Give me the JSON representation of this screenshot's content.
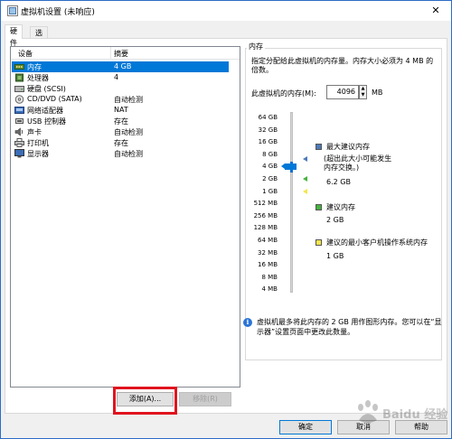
{
  "window": {
    "title": "虚拟机设置 (未响应)",
    "close": "✕"
  },
  "tabs": [
    {
      "label": "硬件",
      "active": true
    },
    {
      "label": "选项",
      "active": false
    }
  ],
  "device_list": {
    "headers": [
      "设备",
      "摘要"
    ],
    "rows": [
      {
        "name": "内存",
        "summary": "4 GB",
        "icon": "memory-icon",
        "selected": true
      },
      {
        "name": "处理器",
        "summary": "4",
        "icon": "processor-icon"
      },
      {
        "name": "硬盘 (SCSI)",
        "summary": "",
        "icon": "hard-disk-icon"
      },
      {
        "name": "CD/DVD (SATA)",
        "summary": "自动检测",
        "icon": "cd-dvd-icon"
      },
      {
        "name": "网络适配器",
        "summary": "NAT",
        "icon": "network-adapter-icon"
      },
      {
        "name": "USB 控制器",
        "summary": "存在",
        "icon": "usb-controller-icon"
      },
      {
        "name": "声卡",
        "summary": "自动检测",
        "icon": "sound-card-icon"
      },
      {
        "name": "打印机",
        "summary": "存在",
        "icon": "printer-icon"
      },
      {
        "name": "显示器",
        "summary": "自动检测",
        "icon": "display-icon"
      }
    ],
    "add_button": "添加(A)...",
    "remove_button": "移除(R)"
  },
  "memory": {
    "group_title": "内存",
    "description": "指定分配给此虚拟机的内存量。内存大小必须为 4 MB 的倍数。",
    "field_label": "此虚拟机的内存(M):",
    "value": "4096",
    "unit": "MB",
    "scale_ticks": [
      "64 GB",
      "32 GB",
      "16 GB",
      "8 GB",
      "4 GB",
      "2 GB",
      "1 GB",
      "512 MB",
      "256 MB",
      "128 MB",
      "64 MB",
      "32 MB",
      "16 MB",
      "8 MB",
      "4 MB"
    ],
    "current_tick": "4 GB",
    "legend": [
      {
        "title": "最大建议内存",
        "note": "(超出此大小可能发生内存交换。)",
        "value": "6.2 GB",
        "color": "#4d7ab8"
      },
      {
        "title": "建议内存",
        "value": "2 GB",
        "color": "#46b33f"
      },
      {
        "title": "建议的最小客户机操作系统内存",
        "value": "1 GB",
        "color": "#f2e64e"
      }
    ],
    "info": "虚拟机最多将此内存的 2 GB 用作图形内存。您可以在“显示器”设置页面中更改此数量。"
  },
  "footer": {
    "ok": "确定",
    "cancel": "取消",
    "help": "帮助"
  },
  "watermark": "Baidu 经验",
  "colors": {
    "selection": "#0078d7",
    "highlight_box": "#e0141e",
    "accent": "#0078d7"
  }
}
